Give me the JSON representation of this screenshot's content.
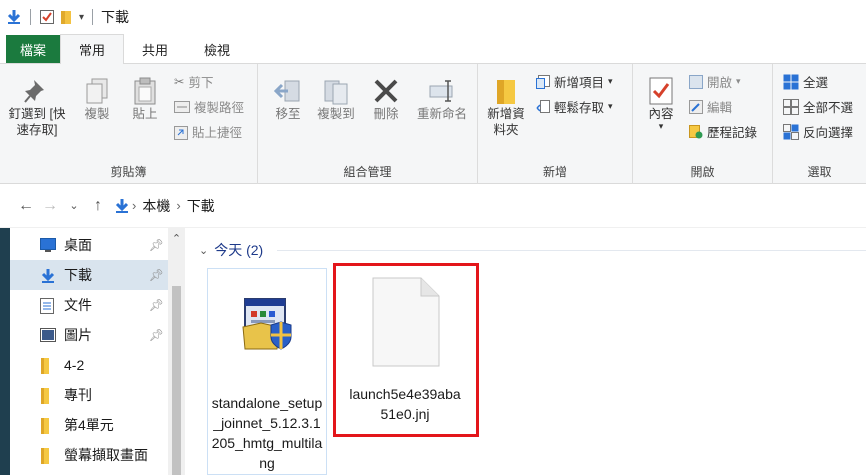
{
  "window": {
    "title": "下載"
  },
  "tabs": [
    {
      "label": "檔案"
    },
    {
      "label": "常用"
    },
    {
      "label": "共用"
    },
    {
      "label": "檢視"
    }
  ],
  "ribbon": {
    "clipboard": {
      "label": "剪貼簿",
      "pin_quick": "釘選到 [快速存取]",
      "copy": "複製",
      "paste": "貼上",
      "cut": "剪下",
      "copy_path": "複製路徑",
      "paste_shortcut": "貼上捷徑"
    },
    "organize": {
      "label": "組合管理",
      "move_to": "移至",
      "copy_to": "複製到",
      "delete": "刪除",
      "rename": "重新命名"
    },
    "new": {
      "label": "新增",
      "new_folder": "新增資料夾",
      "new_item": "新增項目",
      "easy_access": "輕鬆存取"
    },
    "open": {
      "label": "開啟",
      "properties": "內容",
      "open": "開啟",
      "edit": "編輯",
      "history": "歷程記錄"
    },
    "select": {
      "label": "選取",
      "select_all": "全選",
      "select_none": "全部不選",
      "invert": "反向選擇"
    }
  },
  "address": {
    "crumbs": [
      "本機",
      "下載"
    ]
  },
  "nav": {
    "items": [
      {
        "label": "桌面",
        "pinned": true
      },
      {
        "label": "下載",
        "pinned": true,
        "selected": true
      },
      {
        "label": "文件",
        "pinned": true
      },
      {
        "label": "圖片",
        "pinned": true
      },
      {
        "label": "4-2",
        "pinned": false
      },
      {
        "label": "專刊",
        "pinned": false
      },
      {
        "label": "第4單元",
        "pinned": false
      },
      {
        "label": "螢幕擷取畫面",
        "pinned": false
      }
    ]
  },
  "content": {
    "group_header": "今天 (2)",
    "files": [
      {
        "name": "standalone_setup_joinnet_5.12.3.1205_hmtg_multilang",
        "icon": "installer-icon"
      },
      {
        "name": "launch5e4e39aba51e0.jnj",
        "icon": "blank-file-icon"
      }
    ]
  },
  "colors": {
    "file_tab": "#1b7a3e",
    "highlight": "#e3151a",
    "selected_nav": "#d9e4ee",
    "group_header": "#1e3a8a"
  }
}
